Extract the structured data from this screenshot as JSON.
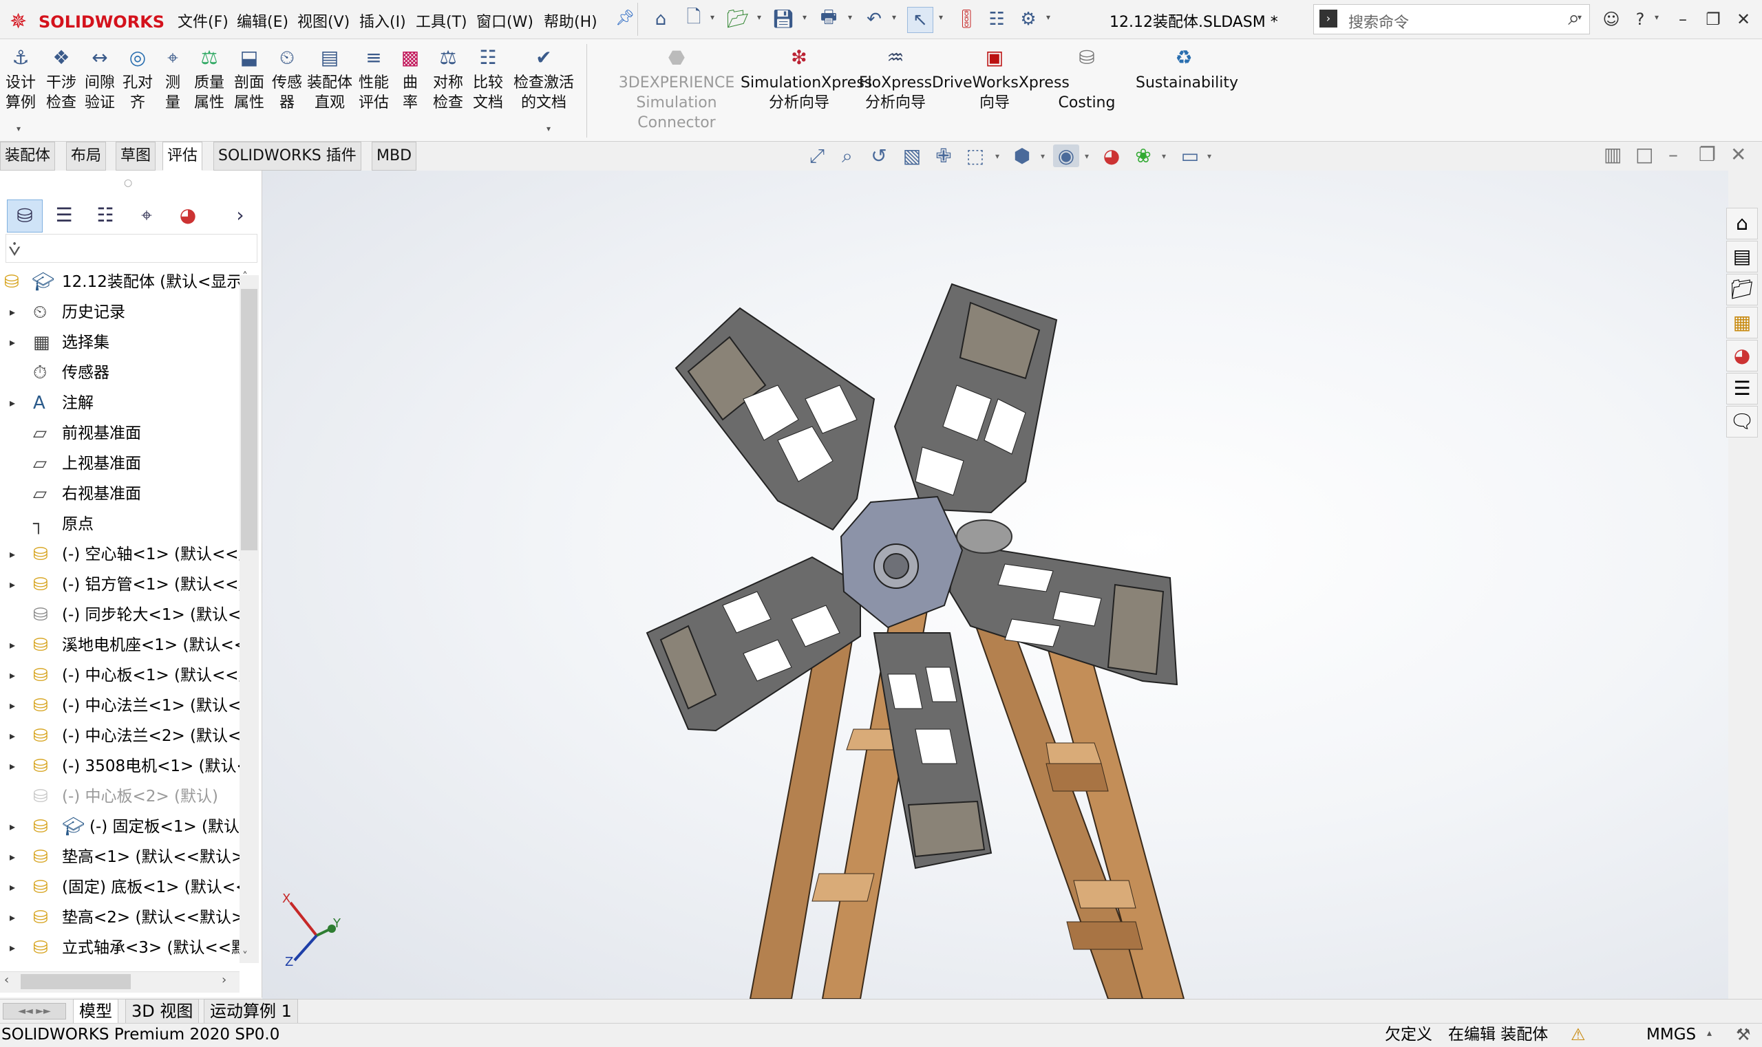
{
  "app": {
    "logo_text": "SOLIDWORKS",
    "document_title": "12.12装配体.SLDASM *"
  },
  "menu": [
    "文件(F)",
    "编辑(E)",
    "视图(V)",
    "插入(I)",
    "工具(T)",
    "窗口(W)",
    "帮助(H)"
  ],
  "search": {
    "placeholder": "搜索命令"
  },
  "ribbon": {
    "buttons": [
      {
        "label1": "设计",
        "label2": "算例",
        "icon": "design-study-icon"
      },
      {
        "label1": "干涉",
        "label2": "检查",
        "icon": "interference-check-icon"
      },
      {
        "label1": "间隙",
        "label2": "验证",
        "icon": "clearance-verification-icon"
      },
      {
        "label1": "孔对",
        "label2": "齐",
        "icon": "hole-alignment-icon"
      },
      {
        "label1": "测",
        "label2": "量",
        "icon": "measure-icon"
      },
      {
        "label1": "质量",
        "label2": "属性",
        "icon": "mass-properties-icon"
      },
      {
        "label1": "剖面",
        "label2": "属性",
        "icon": "section-properties-icon"
      },
      {
        "label1": "传感",
        "label2": "器",
        "icon": "sensor-icon"
      },
      {
        "label1": "装配体",
        "label2": "直观",
        "icon": "assembly-visualization-icon"
      },
      {
        "label1": "性能",
        "label2": "评估",
        "icon": "performance-evaluation-icon"
      },
      {
        "label1": "曲",
        "label2": "率",
        "icon": "curvature-icon"
      },
      {
        "label1": "对称",
        "label2": "检查",
        "icon": "symmetry-check-icon"
      },
      {
        "label1": "比较",
        "label2": "文档",
        "icon": "compare-documents-icon"
      },
      {
        "label1": "检查激活",
        "label2": "的文档",
        "icon": "check-active-document-icon"
      }
    ],
    "addins": [
      {
        "label1": "3DEXPERIENCE",
        "label2": "Simulation Connector",
        "disabled": true
      },
      {
        "label1": "SimulationXpress",
        "label2": "分析向导"
      },
      {
        "label1": "FloXpress",
        "label2": "分析向导"
      },
      {
        "label1": "DriveWorksXpress",
        "label2": "向导"
      },
      {
        "label1": "",
        "label2": "Costing"
      },
      {
        "label1": "Sustainability",
        "label2": ""
      }
    ]
  },
  "command_tabs": [
    "装配体",
    "布局",
    "草图",
    "评估",
    "SOLIDWORKS 插件",
    "MBD"
  ],
  "active_command_tab": "评估",
  "feature_tree": {
    "root": "12.12装配体  (默认<显示",
    "items": [
      {
        "label": "历史记录",
        "icon": "history-icon",
        "expandable": true
      },
      {
        "label": "选择集",
        "icon": "selection-set-icon",
        "expandable": true
      },
      {
        "label": "传感器",
        "icon": "sensor-folder-icon",
        "expandable": false
      },
      {
        "label": "注解",
        "icon": "annotations-icon",
        "expandable": true
      },
      {
        "label": "前视基准面",
        "icon": "plane-icon",
        "expandable": false
      },
      {
        "label": "上视基准面",
        "icon": "plane-icon",
        "expandable": false
      },
      {
        "label": "右视基准面",
        "icon": "plane-icon",
        "expandable": false
      },
      {
        "label": "原点",
        "icon": "origin-icon",
        "expandable": false
      },
      {
        "label": "(-) 空心轴<1> (默认<<默",
        "icon": "part-icon",
        "expandable": true
      },
      {
        "label": "(-) 铝方管<1> (默认<<默",
        "icon": "part-icon",
        "expandable": true
      },
      {
        "label": "(-) 同步轮大<1> (默认<",
        "icon": "part-outline-icon",
        "expandable": false
      },
      {
        "label": "溪地电机座<1> (默认<<",
        "icon": "part-icon",
        "expandable": true
      },
      {
        "label": "(-) 中心板<1> (默认<<默",
        "icon": "part-icon",
        "expandable": true
      },
      {
        "label": "(-) 中心法兰<1> (默认<<",
        "icon": "part-icon",
        "expandable": true
      },
      {
        "label": "(-) 中心法兰<2> (默认<<",
        "icon": "part-icon",
        "expandable": true
      },
      {
        "label": "(-) 3508电机<1> (默认<",
        "icon": "part-icon",
        "expandable": true
      },
      {
        "label": "(-) 中心板<2> (默认)",
        "icon": "part-suppressed-icon",
        "expandable": false,
        "grey": true
      },
      {
        "label": "(-) 固定板<1> (默认",
        "icon": "part-icon",
        "expandable": true,
        "extra_icon": true
      },
      {
        "label": "垫高<1> (默认<<默认>",
        "icon": "part-icon",
        "expandable": true
      },
      {
        "label": "(固定) 底板<1> (默认<<",
        "icon": "part-icon",
        "expandable": true
      },
      {
        "label": "垫高<2> (默认<<默认>",
        "icon": "part-icon",
        "expandable": true
      },
      {
        "label": "立式轴承<3> (默认<<默",
        "icon": "part-icon",
        "expandable": true
      }
    ]
  },
  "bottom_tabs": [
    "模型",
    "3D 视图",
    "运动算例 1"
  ],
  "active_bottom_tab": "模型",
  "status": {
    "version": "SOLIDWORKS Premium 2020 SP0.0",
    "definition": "欠定义",
    "mode": "在编辑 装配体",
    "units": "MMGS"
  },
  "triad": {
    "x": "X",
    "y": "Y",
    "z": "Z"
  },
  "colors": {
    "brand": "#d4121c",
    "plate": "#6b6b6b",
    "wood": "#b4814f",
    "hub": "#8c93a8"
  }
}
